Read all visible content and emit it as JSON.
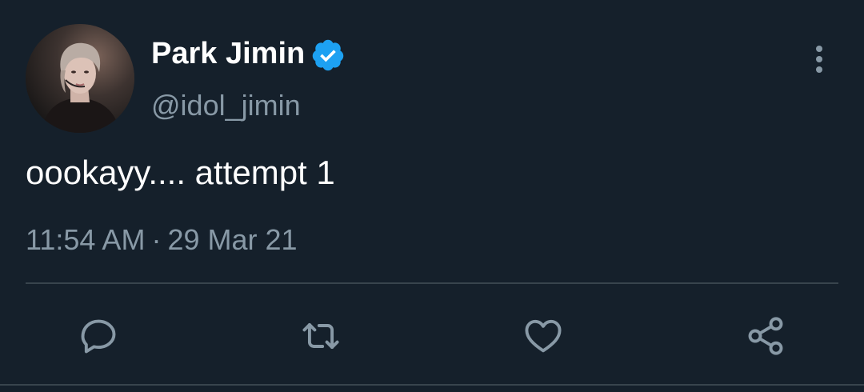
{
  "tweet": {
    "author": {
      "display_name": "Park Jimin",
      "handle": "@idol_jimin",
      "verified": true,
      "verified_color": "#1da1f2"
    },
    "text": "oookayy.... attempt 1",
    "time": "11:54 AM",
    "separator": "·",
    "date": "29 Mar 21"
  },
  "actions": [
    {
      "name": "reply",
      "icon": "reply-icon"
    },
    {
      "name": "retweet",
      "icon": "retweet-icon"
    },
    {
      "name": "like",
      "icon": "heart-icon"
    },
    {
      "name": "share",
      "icon": "share-icon"
    }
  ],
  "colors": {
    "background": "#15202b",
    "primary_text": "#ffffff",
    "secondary_text": "#8899a6",
    "divider": "#38444d"
  }
}
